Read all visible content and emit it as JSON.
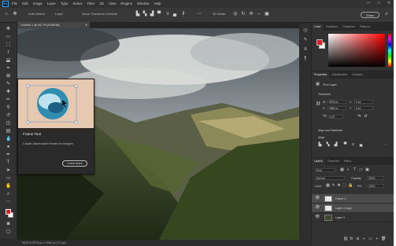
{
  "window": {
    "menu": [
      "File",
      "Edit",
      "Image",
      "Layer",
      "Type",
      "Select",
      "Filter",
      "3D",
      "View",
      "Plugins",
      "Window",
      "Help"
    ],
    "controls": {
      "minimize": "—",
      "maximize": "□",
      "close": "✕"
    }
  },
  "options_bar": {
    "auto_select": "Auto-Select:",
    "layer": "Layer",
    "show_transform": "Show Transform Controls",
    "share_label": "Share"
  },
  "document": {
    "tab_title": "Untitled-1 @ 66.7% (RGB/8#)",
    "status": "66.67%    5976 px x 3984 px (72 ppi)"
  },
  "tooltip": {
    "title": "Frame Tool",
    "description": "Create placeholder frames for images",
    "button": "Learn more"
  },
  "panels": {
    "color_tabs": [
      "Color",
      "Swatches",
      "Gradients",
      "Patterns"
    ],
    "properties_tabs": [
      "Properties",
      "Adjustments",
      "Libraries"
    ],
    "properties": {
      "kind": "Pixel Layer",
      "transform": "Transform",
      "w": "5976 px",
      "h": "3984 px",
      "x": "0 px",
      "y": "0 px",
      "angle": "0.00°",
      "align": "Align and Distribute",
      "align_sub": "Align:"
    },
    "layers_tabs": [
      "Layers",
      "Channels",
      "Paths"
    ],
    "layers": {
      "filter": "Kind",
      "blend": "Normal",
      "opacity_label": "Opacity:",
      "opacity": "100%",
      "lock_label": "Lock:",
      "fill_label": "Fill:",
      "fill": "100%",
      "items": [
        "Frame 1",
        "Layer 1 copy",
        "Layer 1"
      ]
    }
  },
  "colors": {
    "accent": "#31a8ff",
    "foreground": "#e21b23",
    "background": "#ffffff"
  }
}
